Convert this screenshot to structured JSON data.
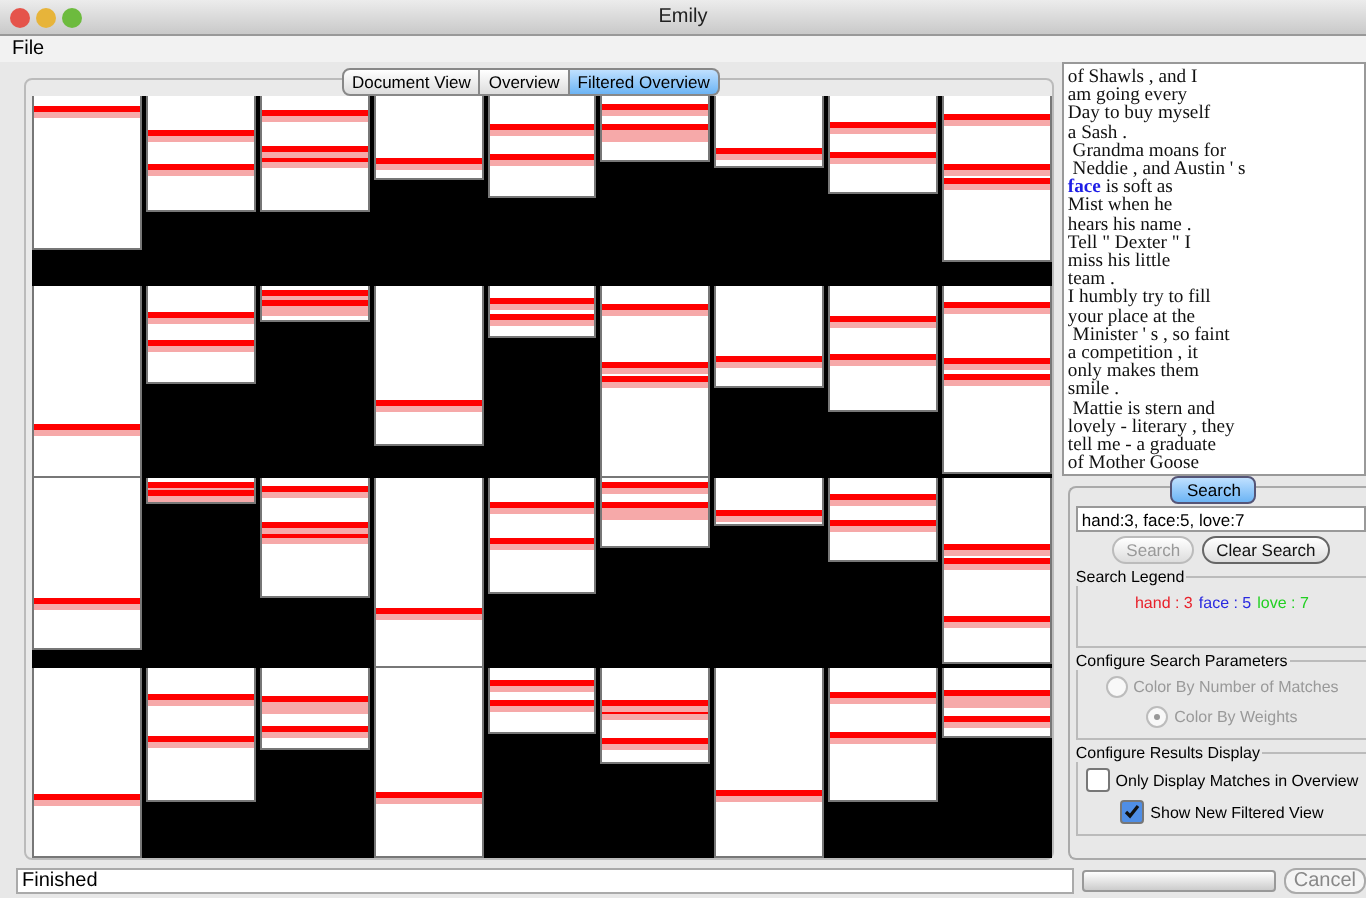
{
  "window": {
    "title": "Emily"
  },
  "menu": [
    "File"
  ],
  "view_tabs": [
    {
      "label": "Document View",
      "selected": false
    },
    {
      "label": "Overview",
      "selected": false
    },
    {
      "label": "Filtered Overview",
      "selected": true
    }
  ],
  "document_text": [
    [
      {
        "text": "of Shawls , and I"
      }
    ],
    [
      {
        "text": "am going every"
      }
    ],
    [
      {
        "text": "Day to buy myself"
      }
    ],
    [
      {
        "text": "a Sash ."
      }
    ],
    [
      {
        "text": " Grandma moans for"
      }
    ],
    [
      {
        "text": " Neddie , and Austin ' s"
      }
    ],
    [
      {
        "text": "face",
        "color": "#1e1ee6"
      },
      {
        "text": " is soft as"
      }
    ],
    [
      {
        "text": "Mist when he"
      }
    ],
    [
      {
        "text": "hears his name ."
      }
    ],
    [
      {
        "text": "Tell \" Dexter \" I"
      }
    ],
    [
      {
        "text": "miss his little"
      }
    ],
    [
      {
        "text": "team ."
      }
    ],
    [
      {
        "text": "I humbly try to fill"
      }
    ],
    [
      {
        "text": "your place at the"
      }
    ],
    [
      {
        "text": " Minister ' s , so faint"
      }
    ],
    [
      {
        "text": "a competition , it"
      }
    ],
    [
      {
        "text": "only makes them"
      }
    ],
    [
      {
        "text": "smile ."
      }
    ],
    [
      {
        "text": " Mattie is stern and"
      }
    ],
    [
      {
        "text": "lovely - literary , they"
      }
    ],
    [
      {
        "text": "tell me - a graduate"
      }
    ],
    [
      {
        "text": "of Mother Goose"
      }
    ]
  ],
  "search_panel": {
    "tab": "Search",
    "query": "hand:3, face:5, love:7",
    "buttons": [
      {
        "label": "Search",
        "disabled": true
      },
      {
        "label": "Clear Search",
        "disabled": false
      }
    ],
    "legend": {
      "title": "Search Legend",
      "items": [
        {
          "text": "hand : 3",
          "color": "#e8202a"
        },
        {
          "text": "face : 5",
          "color": "#2a2ae0"
        },
        {
          "text": "love : 7",
          "color": "#22d022"
        }
      ]
    },
    "parameters": {
      "title": "Configure Search Parameters",
      "options": [
        {
          "label": "Color By Number of Matches",
          "selected": false,
          "disabled": true
        },
        {
          "label": "Color By Weights",
          "selected": true,
          "disabled": true
        }
      ]
    },
    "display": {
      "title": "Configure Results Display",
      "options": [
        {
          "label": "Only Display Matches in Overview",
          "checked": false
        },
        {
          "label": "Show New Filtered View",
          "checked": true
        }
      ]
    }
  },
  "status_bar": {
    "text": "Finished",
    "progress": {
      "level": 0
    },
    "cancel": "Cancel"
  }
}
